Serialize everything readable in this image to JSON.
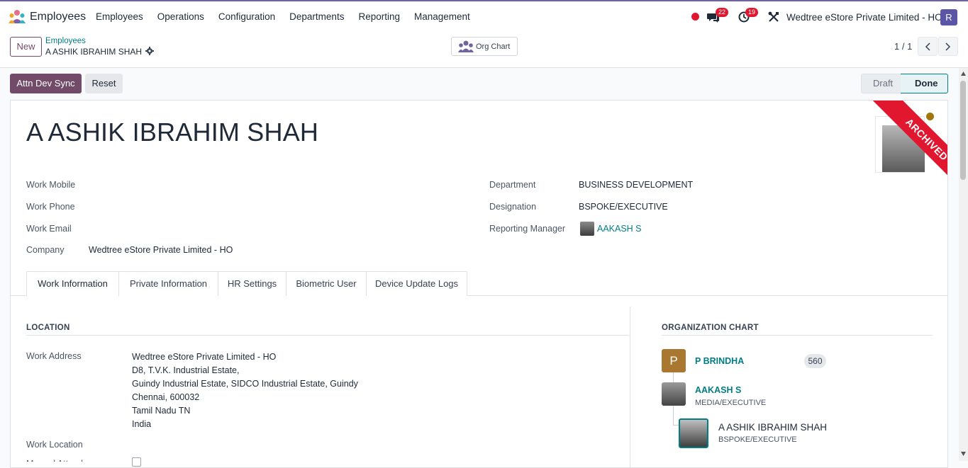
{
  "topbar": {
    "app_name": "Employees",
    "menu": [
      "Employees",
      "Operations",
      "Configuration",
      "Departments",
      "Reporting",
      "Management"
    ],
    "chat_count": "22",
    "activity_count": "19",
    "company": "Wedtree eStore Private Limited - HO",
    "user_initial": "R"
  },
  "control": {
    "new_label": "New",
    "breadcrumb": "Employees",
    "record_name": "A ASHIK IBRAHIM SHAH",
    "org_chart_label": "Org Chart",
    "pager": "1 / 1"
  },
  "actions": {
    "attn_sync": "Attn Dev Sync",
    "reset": "Reset",
    "status_draft": "Draft",
    "status_done": "Done"
  },
  "employee": {
    "name": "A ASHIK IBRAHIM SHAH",
    "ribbon": "ARCHIVED",
    "fields_left": [
      {
        "label": "Work Mobile",
        "value": ""
      },
      {
        "label": "Work Phone",
        "value": ""
      },
      {
        "label": "Work Email",
        "value": ""
      },
      {
        "label": "Company",
        "value": "Wedtree eStore Private Limited - HO"
      }
    ],
    "fields_right": [
      {
        "label": "Department",
        "value": "BUSINESS DEVELOPMENT"
      },
      {
        "label": "Designation",
        "value": "BSPOKE/EXECUTIVE"
      },
      {
        "label": "Reporting Manager",
        "value": "AAKASH S"
      }
    ]
  },
  "tabs": [
    "Work Information",
    "Private Information",
    "HR Settings",
    "Biometric User",
    "Device Update Logs"
  ],
  "location": {
    "title": "LOCATION",
    "work_address_label": "Work Address",
    "address_lines": [
      "Wedtree eStore Private Limited - HO",
      "D8, T.V.K. Industrial Estate,",
      "Guindy Industrial Estate, SIDCO Industrial Estate, Guindy",
      "Chennai, 600032",
      "Tamil Nadu TN",
      "India"
    ],
    "work_location_label": "Work Location",
    "cut_label": "Manual Attendance"
  },
  "org_chart": {
    "title": "ORGANIZATION CHART",
    "top": {
      "initial": "P",
      "name": "P BRINDHA",
      "count": "560"
    },
    "manager": {
      "name": "AAKASH S",
      "job": "MEDIA/EXECUTIVE"
    },
    "self": {
      "name": "A ASHIK IBRAHIM SHAH",
      "job": "BSPOKE/EXECUTIVE"
    }
  }
}
